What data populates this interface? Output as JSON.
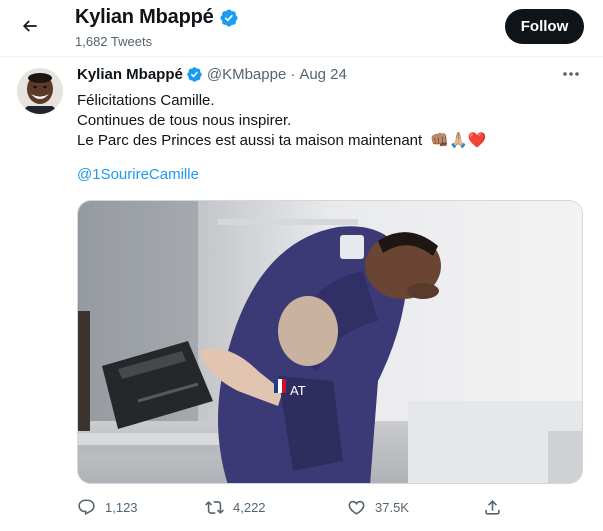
{
  "header": {
    "name": "Kylian Mbappé",
    "tweet_count": "1,682 Tweets",
    "follow_label": "Follow"
  },
  "tweet": {
    "author_name": "Kylian Mbappé",
    "handle": "@KMbappe",
    "separator": "·",
    "date": "Aug 24",
    "lines": [
      "Félicitations Camille.",
      "Continues de tous nous inspirer.",
      "Le Parc des Princes est aussi ta maison maintenant"
    ],
    "emojis": "👊🏽🙏🏼❤️",
    "hashtag": "@1SourireCamille",
    "jersey_text": "AT"
  },
  "actions": {
    "replies": "1,123",
    "retweets": "4,222",
    "likes": "37.5K"
  },
  "icons": {
    "back": "arrow-left-icon",
    "verified": "verified-badge-icon",
    "more": "more-horizontal-icon",
    "reply": "reply-icon",
    "retweet": "retweet-icon",
    "like": "heart-icon",
    "share": "share-icon"
  },
  "colors": {
    "text": "#0f1419",
    "secondary": "#536471",
    "link": "#1d9bf0",
    "verified": "#1d9bf0",
    "follow_bg": "#0f1419",
    "border": "#eff3f4"
  }
}
